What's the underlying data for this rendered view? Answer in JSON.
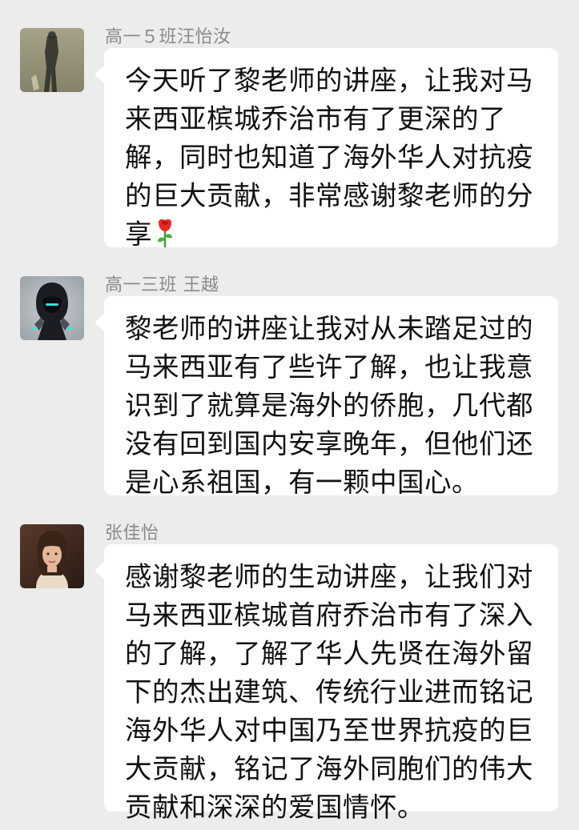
{
  "messages": [
    {
      "sender": "高一５班汪怡汝",
      "lines": [
        "今天听了黎老师的讲座，让我对马",
        "来西亚槟城乔治市有了更深的了",
        "解，同时也知道了海外华人对抗疫",
        "的巨大贡献，非常感谢黎老师的分",
        "享"
      ],
      "emoji": "rose-emoji"
    },
    {
      "sender": "高一三班 王越",
      "lines": [
        "黎老师的讲座让我对从未踏足过的",
        "马来西亚有了些许了解，也让我意",
        "识到了就算是海外的侨胞，几代都",
        "没有回到国内安享晚年，但他们还",
        "是心系祖国，有一颗中国心。"
      ]
    },
    {
      "sender": "张佳怡",
      "lines": [
        "感谢黎老师的生动讲座，让我们对",
        "马来西亚槟城首府乔治市有了深入",
        "的了解，了解了华人先贤在海外留",
        "下的杰出建筑、传统行业进而铭记",
        "海外华人对中国乃至世界抗疫的巨",
        "大贡献，铭记了海外同胞们的伟大",
        "贡献和深深的爱国情怀。"
      ]
    }
  ],
  "colors": {
    "background": "#ececec",
    "bubble": "#ffffff",
    "sender_name": "#8a8a8a",
    "text": "#111111"
  }
}
